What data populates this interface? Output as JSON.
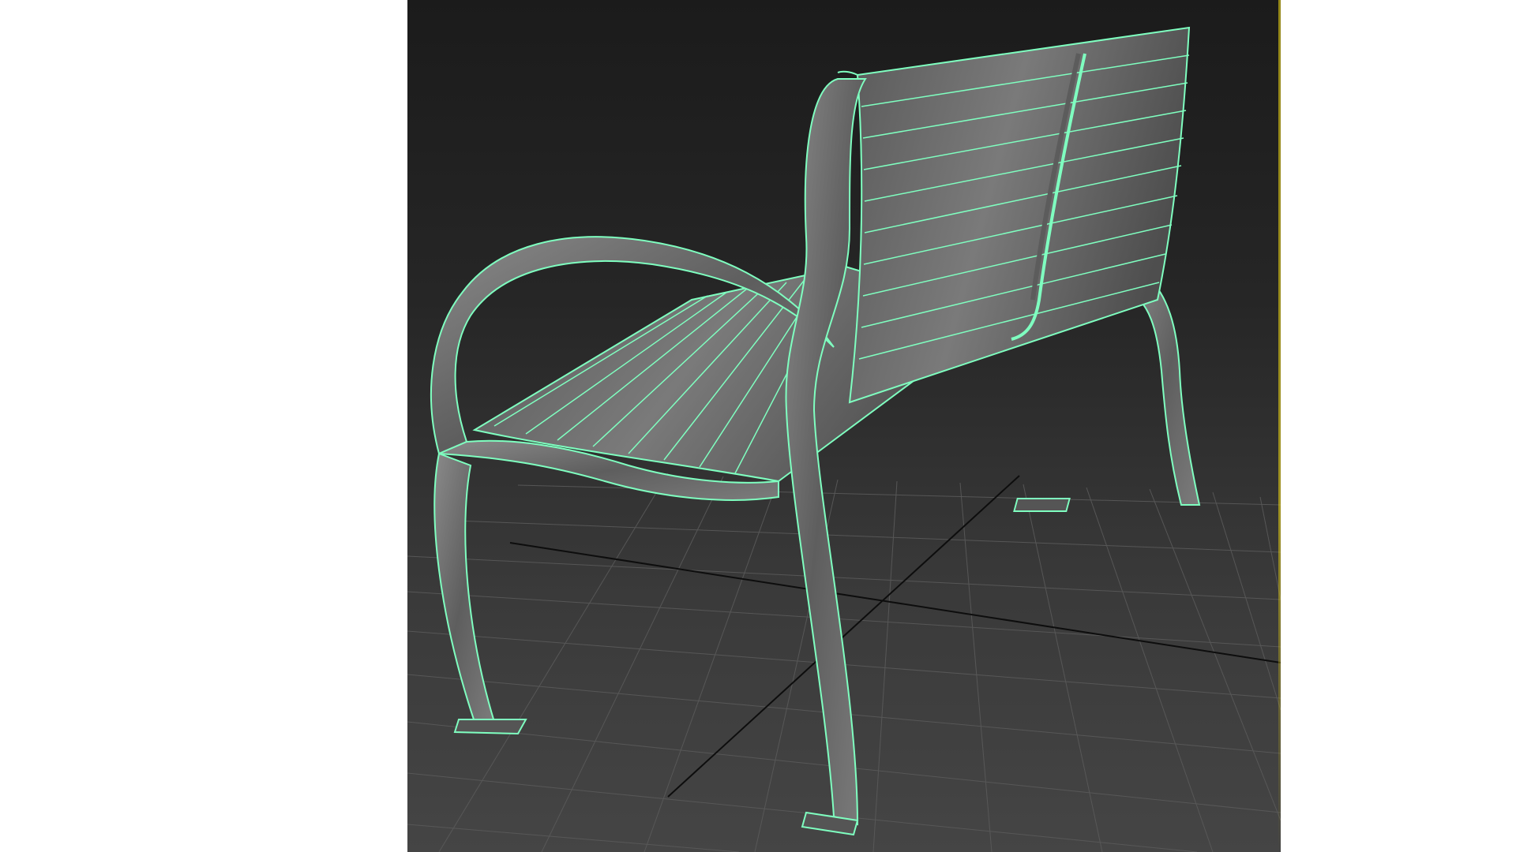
{
  "viewport": {
    "object": "bench-model",
    "display_mode": "shaded-with-wireframe",
    "wireframe_color": "#7fffc0",
    "grid_color": "#5a5a5a",
    "grid_axis_color": "#0a0a0a",
    "background_top": "#1b1b1b",
    "background_bottom": "#454545",
    "active_border_color": "#e8d21a"
  }
}
